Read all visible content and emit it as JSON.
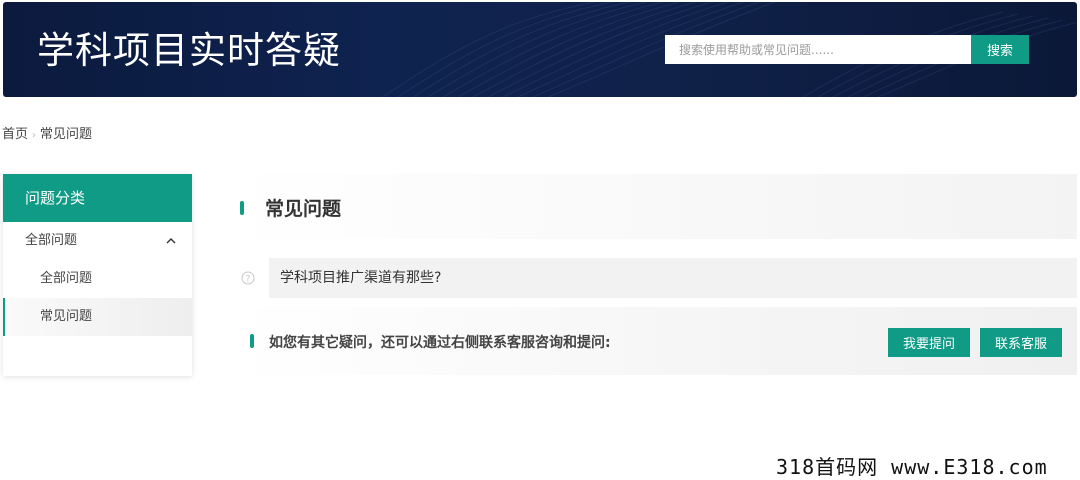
{
  "header": {
    "title": "学科项目实时答疑",
    "search_placeholder": "搜索使用帮助或常见问题......",
    "search_button": "搜索"
  },
  "breadcrumb": {
    "home": "首页",
    "separator": "›",
    "current": "常见问题"
  },
  "sidebar": {
    "title": "问题分类",
    "category": "全部问题",
    "items": [
      {
        "label": "全部问题",
        "active": false
      },
      {
        "label": "常见问题",
        "active": true
      }
    ]
  },
  "main": {
    "title": "常见问题",
    "questions": [
      "学科项目推广渠道有那些?"
    ],
    "contact_text": "如您有其它疑问，还可以通过右侧联系客服咨询和提问:",
    "ask_button": "我要提问",
    "service_button": "联系客服"
  },
  "watermark": "318首码网 www.E318.com",
  "colors": {
    "accent": "#0f9b86",
    "banner": "#0f2350"
  }
}
